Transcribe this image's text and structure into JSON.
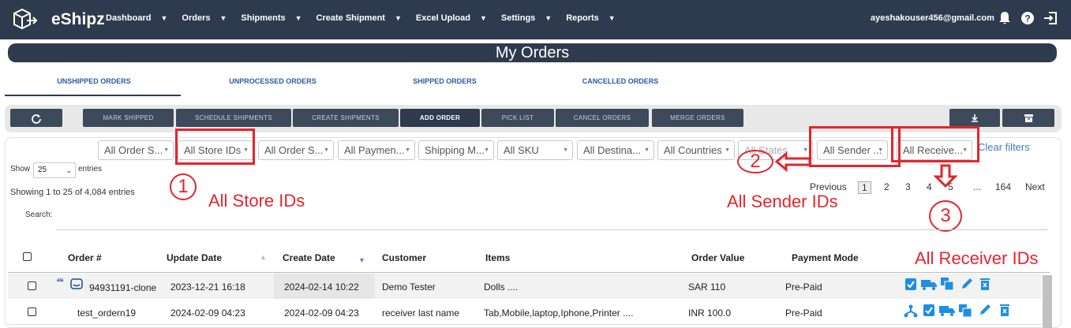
{
  "app": {
    "brand": "eShipz",
    "user_email": "ayeshakouser456@gmail.com"
  },
  "nav": {
    "items": [
      {
        "label": "Dashboard"
      },
      {
        "label": "Orders"
      },
      {
        "label": "Shipments"
      },
      {
        "label": "Create Shipment"
      },
      {
        "label": "Excel Upload"
      },
      {
        "label": "Settings"
      },
      {
        "label": "Reports"
      }
    ]
  },
  "page": {
    "title": "My Orders"
  },
  "tabs": [
    {
      "label": "UNSHIPPED ORDERS",
      "active": true
    },
    {
      "label": "UNPROCESSED ORDERS"
    },
    {
      "label": "SHIPPED ORDERS"
    },
    {
      "label": "CANCELLED ORDERS"
    }
  ],
  "toolbar": {
    "mark_shipped": "MARK SHIPPED",
    "schedule_shipments": "SCHEDULE SHIPMENTS",
    "create_shipments": "CREATE SHIPMENTS",
    "add_order": "ADD ORDER",
    "pick_list": "PICK LIST",
    "cancel_orders": "CANCEL ORDERS",
    "merge_orders": "MERGE ORDERS"
  },
  "filters": {
    "order_source": "All Order S...",
    "store_ids": "All Store IDs",
    "order_status": "All Order S...",
    "payment": "All Paymen...",
    "shipping_method": "Shipping M...",
    "sku": "All SKU",
    "destination": "All Destina...",
    "countries": "All Countries",
    "states": "All States",
    "sender": "All Sender ...",
    "receiver": "All Receive...",
    "clear": "Clear filters"
  },
  "annotations": {
    "n1": "1",
    "label1": "All Store IDs",
    "n2": "2",
    "label2": "All Sender IDs",
    "n3": "3",
    "label3": "All Receiver IDs"
  },
  "table_controls": {
    "show_label": "Show",
    "page_size": "25",
    "entries_label": "entries",
    "info": "Showing 1 to 25 of 4,084 entries",
    "search_label": "Search:"
  },
  "pagination": {
    "previous": "Previous",
    "pages": [
      "1",
      "2",
      "3",
      "4",
      "5",
      "...",
      "164"
    ],
    "next": "Next"
  },
  "columns": [
    "Order #",
    "Update Date",
    "Create Date",
    "Customer",
    "Items",
    "Order Value",
    "Payment Mode"
  ],
  "rows": [
    {
      "order": "94931191-clone",
      "update": "2023-12-21 16:18",
      "create": "2024-02-14 10:22",
      "customer": "Demo Tester",
      "items": "Dolls ....",
      "value": "SAR 110",
      "payment": "Pre-Paid",
      "store_logo": "ala"
    },
    {
      "order": "test_ordern19",
      "update": "2024-02-09 04:23",
      "create": "2024-02-09 04:23",
      "customer": "receiver last name",
      "items": "Tab,Mobile,laptop,Iphone,Printer ....",
      "value": "INR 100.0",
      "payment": "Pre-Paid"
    }
  ],
  "colors": {
    "nav_bg": "#2e3b4e",
    "accent_blue": "#1f8ee0",
    "annotation_red": "#e4252d"
  }
}
